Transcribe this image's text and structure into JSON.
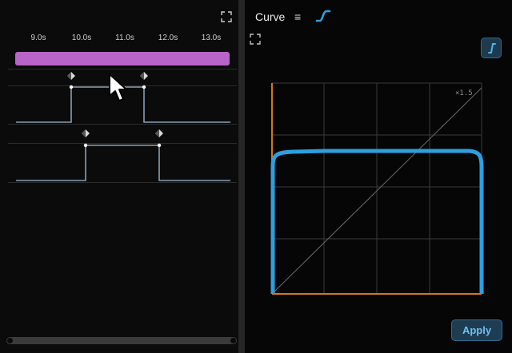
{
  "timeline": {
    "ruler_labels": [
      "9.0s",
      "10.0s",
      "11.0s",
      "12.0s",
      "13.0s"
    ],
    "clip_color": "#b864c8"
  },
  "curve_panel": {
    "title": "Curve",
    "menu_icon": "≡",
    "scale_label": "×1.5",
    "apply_label": "Apply",
    "curve_color": "#2d9fe0",
    "axis_color": "#d2781e"
  },
  "icons": [
    "expand-icon",
    "menu-icon",
    "curve-mode-icon",
    "ease-preset-icon",
    "keyframe-icon",
    "mouse-cursor-icon"
  ]
}
